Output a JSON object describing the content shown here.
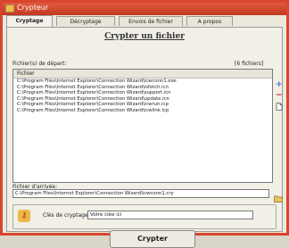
{
  "window": {
    "title": "Crypteur"
  },
  "tabs": [
    "Cryptage",
    "Décryptage",
    "Envois de fichier",
    "A propos"
  ],
  "heading": "Crypter un fichier",
  "files": {
    "label": "Fichier(s) de départ:",
    "count_label": "[6 fichiers]",
    "column_header": "Fichier",
    "rows": [
      "C:\\Program Files\\Internet Explorer\\Connection Wizard\\icwconn1.exe",
      "C:\\Program Files\\Internet Explorer\\Connection Wizard\\isfetch.icn",
      "C:\\Program Files\\Internet Explorer\\Connection Wizard\\support.icn",
      "C:\\Program Files\\Internet Explorer\\Connection Wizard\\update.icn",
      "C:\\Program Files\\Internet Explorer\\Connection Wizard\\icwrun.icp",
      "C:\\Program Files\\Internet Explorer\\Connection Wizard\\icwlink.icp"
    ]
  },
  "output": {
    "label": "Fichier d'arrivée:",
    "path": "C:\\Program Files\\Internet Explorer\\Connection Wizard\\icwconn1.cry"
  },
  "key": {
    "label": "Clés de cryptage:",
    "value": "Votre clée ici"
  },
  "action_button": "Crypter"
}
